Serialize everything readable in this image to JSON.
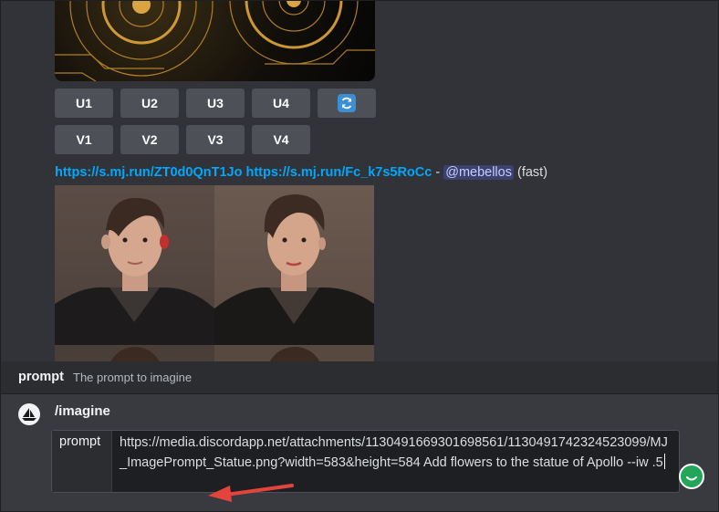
{
  "buttons": {
    "upscale": [
      "U1",
      "U2",
      "U3",
      "U4"
    ],
    "variation": [
      "V1",
      "V2",
      "V3",
      "V4"
    ],
    "reroll_icon": "refresh-icon"
  },
  "message": {
    "link1": "https://s.mj.run/ZT0d0QnT1Jo",
    "link2": "https://s.mj.run/Fc_k7s5RoCc",
    "separator": " - ",
    "mention": "@mebellos",
    "speed": "(fast)"
  },
  "command_panel": {
    "option_name": "prompt",
    "option_description": "The prompt to imagine",
    "command": "/imagine",
    "field_label": "prompt",
    "field_value": "https://media.discordapp.net/attachments/1130491669301698561/1130491742324523099/MJ_ImagePrompt_Statue.png?width=583&height=584 Add flowers to the statue of Apollo --iw .5"
  },
  "colors": {
    "link": "#00a8fc",
    "mention_bg": "#3c4270",
    "button_bg": "#4e5058",
    "annotation_arrow": "#e5443c",
    "status_green": "#23a55a"
  }
}
